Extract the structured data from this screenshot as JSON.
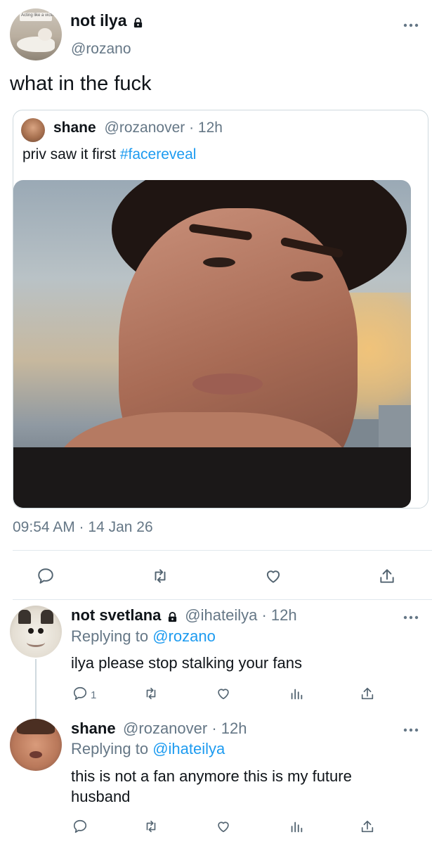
{
  "main_tweet": {
    "name": "not ilya",
    "handle": "@rozano",
    "text": "what in the fuck",
    "avatar_caption": "Acting like a victim",
    "timestamp": "09:54 AM · 14 Jan 26"
  },
  "quoted_tweet": {
    "name": "shane",
    "handle_time": "@rozanover · 12h",
    "text_plain": "priv saw it first",
    "hashtag": "#facereveal"
  },
  "actions": {
    "reply_icon": "reply-icon",
    "retweet_icon": "retweet-icon",
    "like_icon": "heart-icon",
    "share_icon": "share-icon"
  },
  "replies": [
    {
      "name": "not svetlana",
      "handle_time": "@ihateilya · 12h",
      "replying_prefix": "Replying to",
      "replying_to": "@rozano",
      "text": "ilya please stop stalking your fans",
      "reply_count": "1"
    },
    {
      "name": "shane",
      "handle_time": "@rozanover · 12h",
      "replying_prefix": "Replying to",
      "replying_to": "@ihateilya",
      "text": "this is not a fan anymore this is my future husband"
    }
  ],
  "colors": {
    "link": "#1d9bf0",
    "muted": "#657786",
    "divider": "#e1e8ed"
  }
}
